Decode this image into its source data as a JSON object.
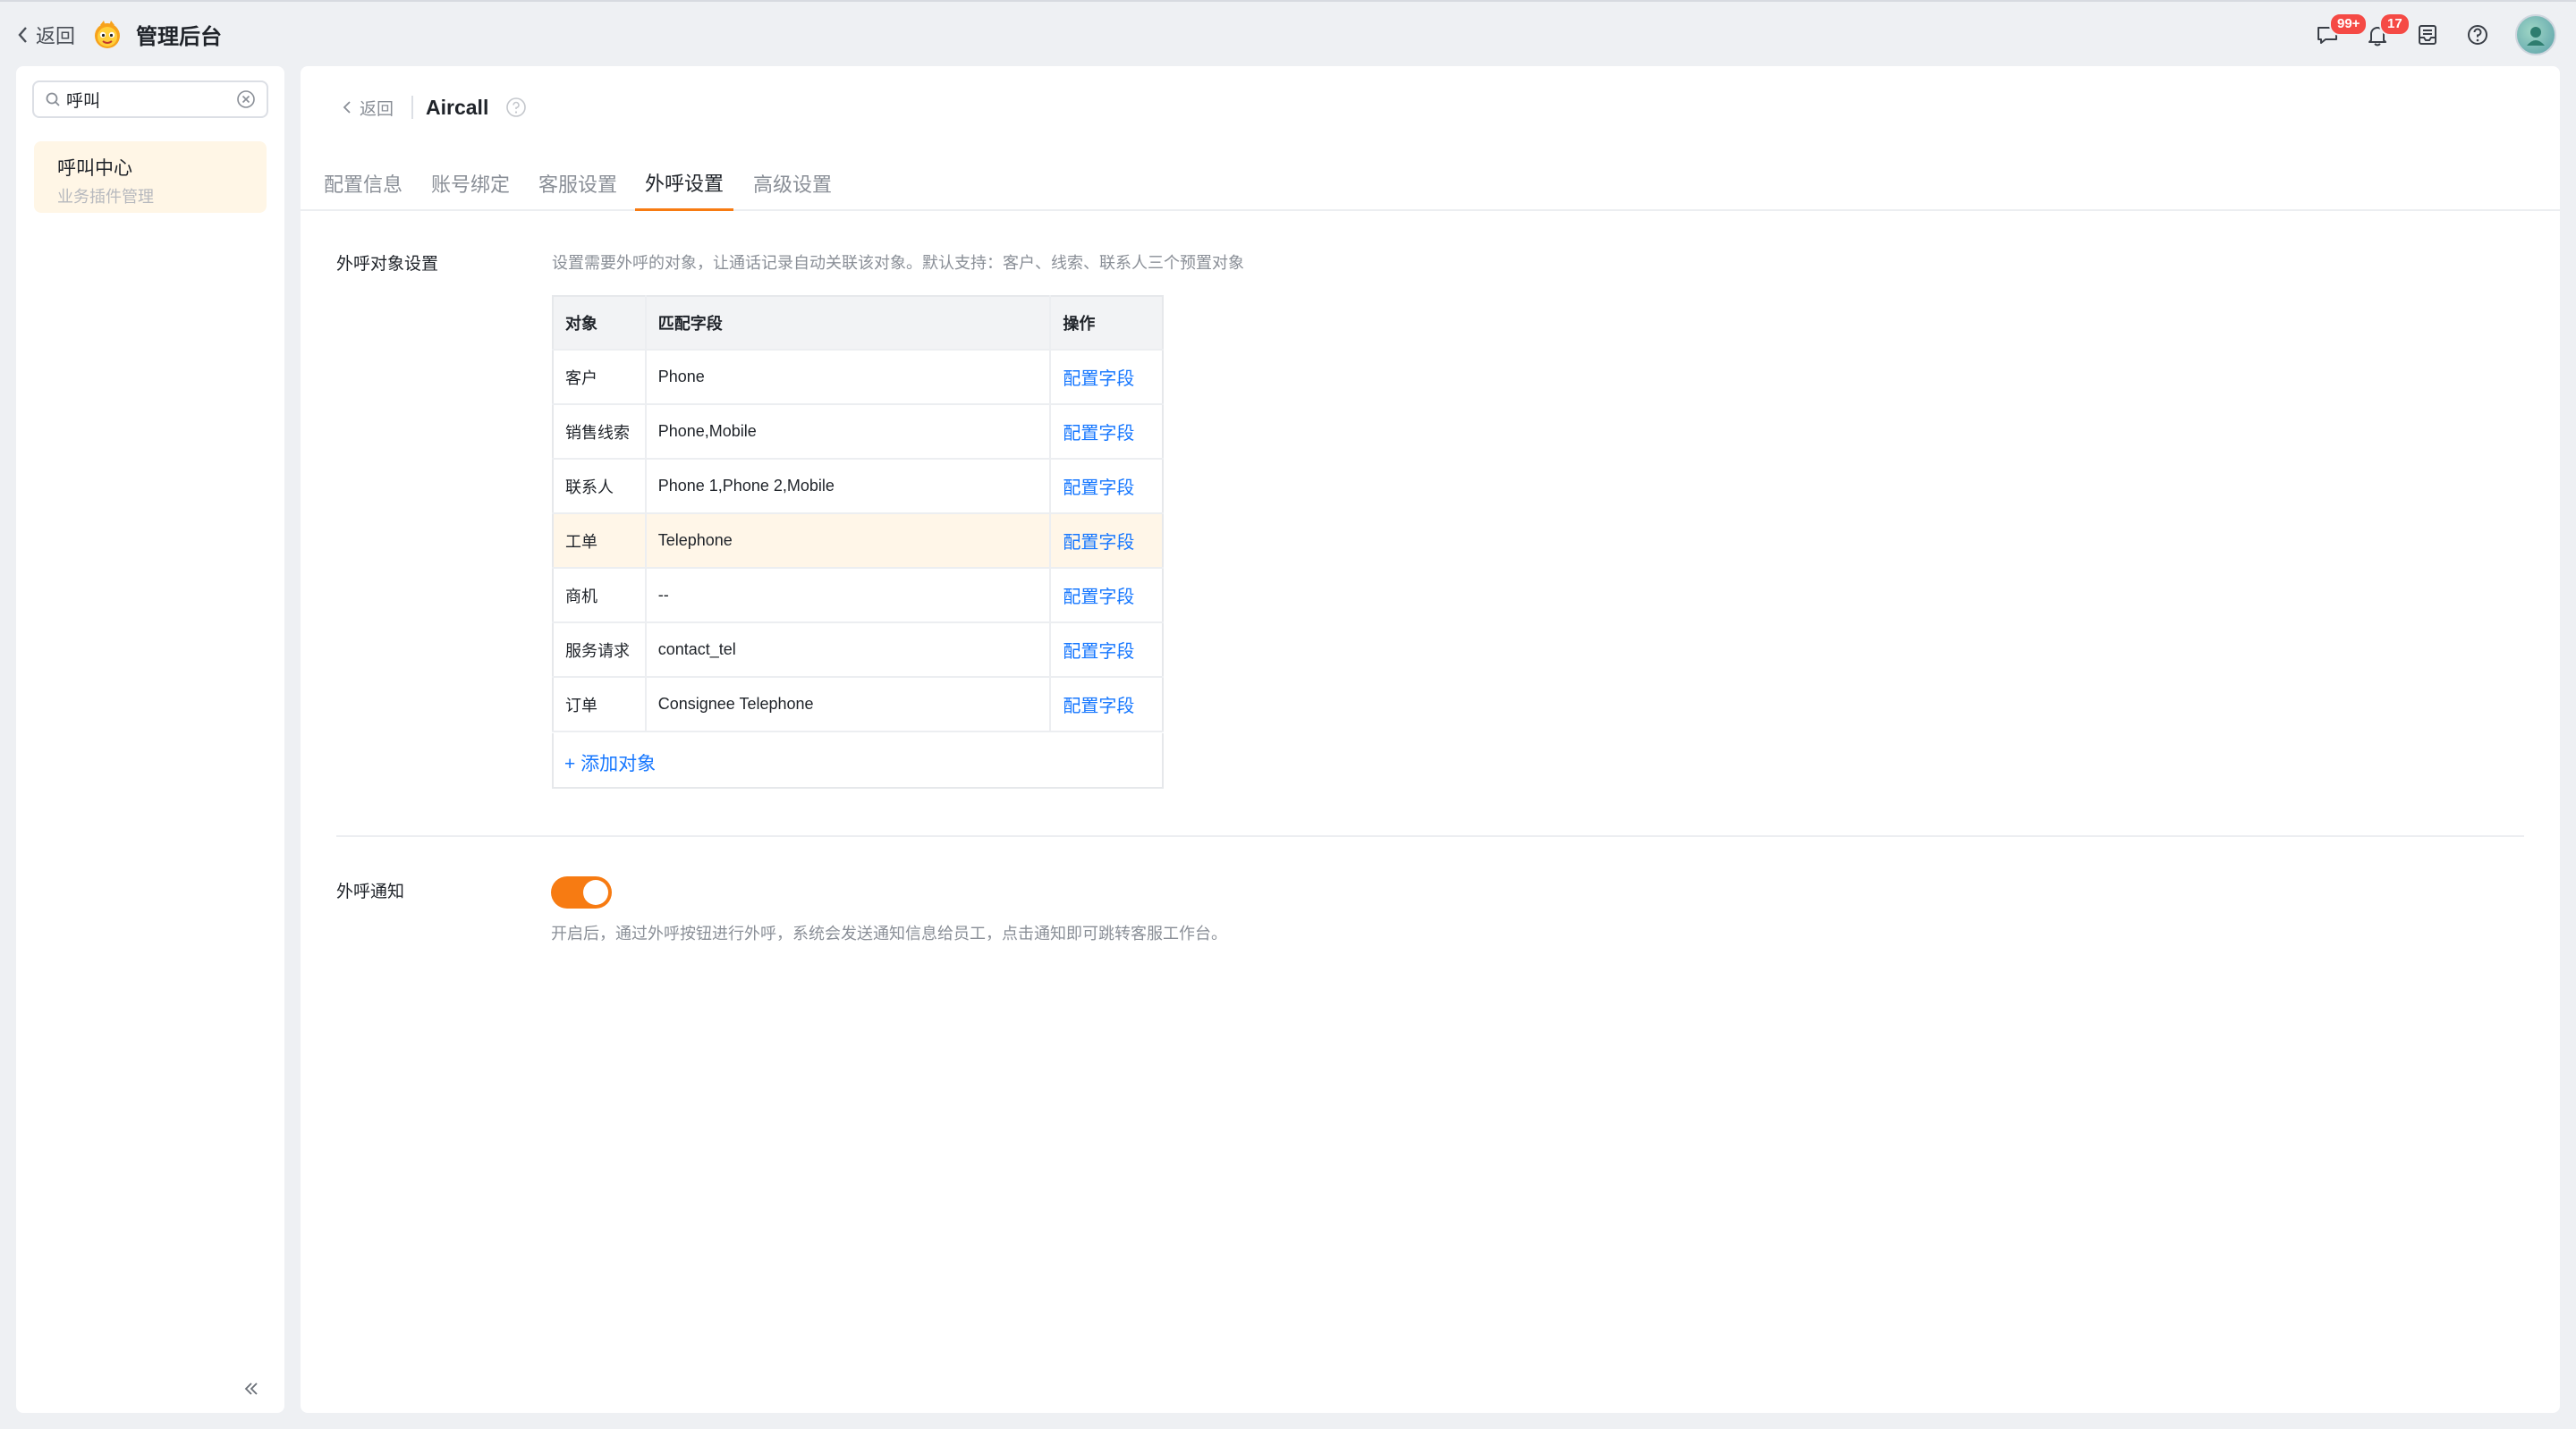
{
  "topbar": {
    "back_label": "返回",
    "title": "管理后台",
    "badges": {
      "messages": "99+",
      "notifications": "17"
    },
    "icons": [
      "chat-icon",
      "bell-icon",
      "inbox-icon",
      "help-icon"
    ]
  },
  "sidebar": {
    "search_value": "呼叫",
    "item": {
      "title": "呼叫中心",
      "subtitle": "业务插件管理"
    }
  },
  "main": {
    "back_label": "返回",
    "app_name": "Aircall",
    "tabs": [
      {
        "label": "配置信息"
      },
      {
        "label": "账号绑定"
      },
      {
        "label": "客服设置"
      },
      {
        "label": "外呼设置"
      },
      {
        "label": "高级设置"
      }
    ],
    "active_tab": "外呼设置",
    "outbound_objects": {
      "label": "外呼对象设置",
      "hint": "设置需要外呼的对象，让通话记录自动关联该对象。默认支持：客户、线索、联系人三个预置对象",
      "columns": [
        "对象",
        "匹配字段",
        "操作"
      ],
      "rows": [
        {
          "object": "客户",
          "field": "Phone",
          "action": "配置字段"
        },
        {
          "object": "销售线索",
          "field": "Phone,Mobile",
          "action": "配置字段"
        },
        {
          "object": "联系人",
          "field": "Phone 1,Phone 2,Mobile",
          "action": "配置字段"
        },
        {
          "object": "工单",
          "field": "Telephone",
          "action": "配置字段"
        },
        {
          "object": "商机",
          "field": "--",
          "action": "配置字段"
        },
        {
          "object": "服务请求",
          "field": "contact_tel",
          "action": "配置字段"
        },
        {
          "object": "订单",
          "field": "Consignee Telephone",
          "action": "配置字段"
        }
      ],
      "add_label": "+ 添加对象"
    },
    "outbound_notice": {
      "label": "外呼通知",
      "enabled": true,
      "hint": "开启后，通过外呼按钮进行外呼，系统会发送通知信息给员工，点击通知即可跳转客服工作台。"
    }
  },
  "colors": {
    "accent": "#f77b12",
    "link": "#1677ff",
    "badge": "#f54a45",
    "highlight_row": "#fff6e8"
  }
}
